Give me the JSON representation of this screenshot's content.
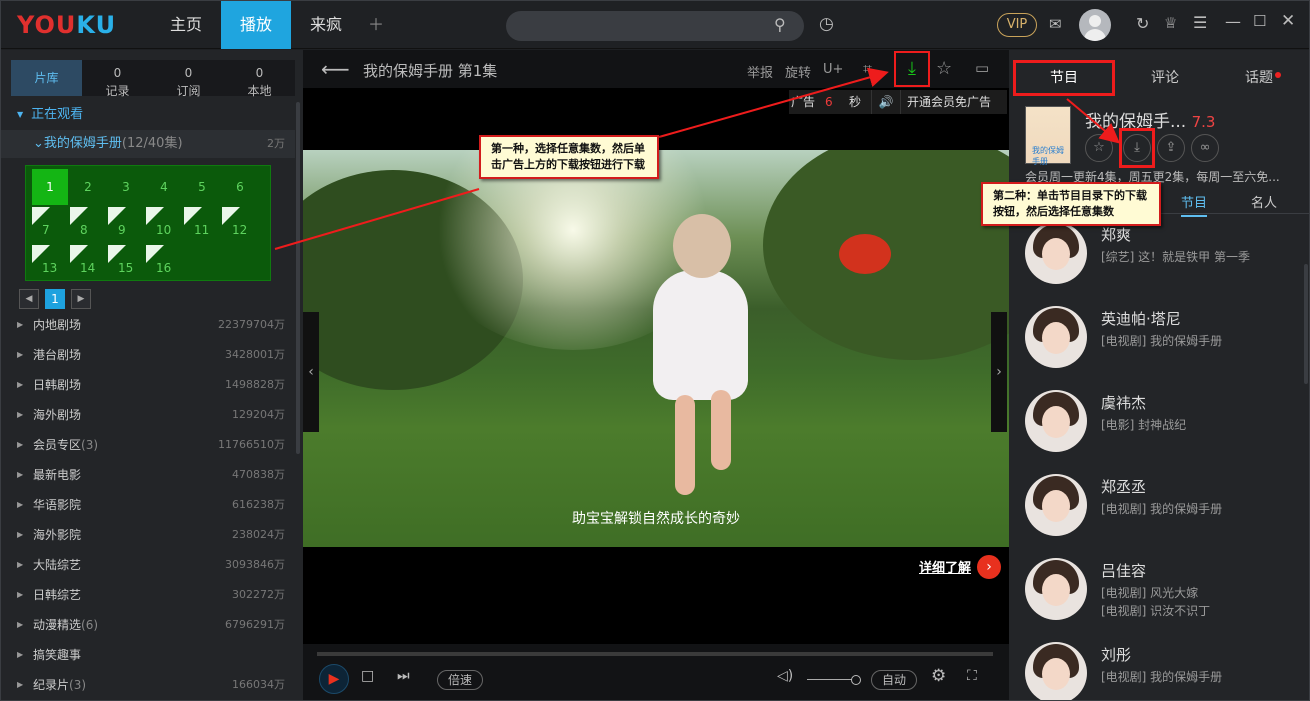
{
  "app": {
    "logo": "YOUKU",
    "nav": [
      "主页",
      "播放",
      "来疯"
    ],
    "nav_active_index": 1,
    "search_placeholder": "",
    "vip_label": "VIP"
  },
  "left_panel": {
    "tabs": [
      {
        "label": "片库",
        "count": ""
      },
      {
        "label": "记录",
        "count": "0"
      },
      {
        "label": "订阅",
        "count": "0"
      },
      {
        "label": "本地",
        "count": "0"
      }
    ],
    "watching_label": "正在观看",
    "current_show": {
      "name": "我的保姆手册",
      "count": "(12/40集)",
      "views": "2万"
    },
    "episodes": [
      "1",
      "2",
      "3",
      "4",
      "5",
      "6",
      "7",
      "8",
      "9",
      "10",
      "11",
      "12",
      "13",
      "14",
      "15",
      "16"
    ],
    "current_episode_index": 0,
    "flagged_from_index": 6,
    "page": "1",
    "categories": [
      {
        "name": "内地剧场",
        "count": "",
        "views": "22379704万"
      },
      {
        "name": "港台剧场",
        "count": "",
        "views": "3428001万"
      },
      {
        "name": "日韩剧场",
        "count": "",
        "views": "1498828万"
      },
      {
        "name": "海外剧场",
        "count": "",
        "views": "129204万"
      },
      {
        "name": "会员专区",
        "count": "(3)",
        "views": "11766510万"
      },
      {
        "name": "最新电影",
        "count": "",
        "views": "470838万"
      },
      {
        "name": "华语影院",
        "count": "",
        "views": "616238万"
      },
      {
        "name": "海外影院",
        "count": "",
        "views": "238024万"
      },
      {
        "name": "大陆综艺",
        "count": "",
        "views": "3093846万"
      },
      {
        "name": "日韩综艺",
        "count": "",
        "views": "302272万"
      },
      {
        "name": "动漫精选",
        "count": "(6)",
        "views": "6796291万"
      },
      {
        "name": "搞笑趣事",
        "count": "",
        "views": ""
      },
      {
        "name": "纪录片",
        "count": "(3)",
        "views": "166034万"
      }
    ]
  },
  "player": {
    "title": "我的保姆手册 第1集",
    "tools": [
      "举报",
      "旋转",
      "U+"
    ],
    "ad": {
      "label": "广告",
      "seconds": "6",
      "unit": "秒",
      "vip_skip": "开通会员免广告"
    },
    "subtitle": "助宝宝解锁自然成长的奇妙",
    "detail_link": "详细了解",
    "speed_label": "倍速",
    "quality_label": "自动"
  },
  "right_panel": {
    "tabs": [
      "节目",
      "评论",
      "话题"
    ],
    "show_title": "我的保姆手...",
    "score": "7.3",
    "poster_text": "我的保姆手册",
    "description": "会员周一更新4集，周五更2集，每周一至六免...",
    "subtabs": [
      "节目",
      "名人"
    ],
    "people": [
      {
        "name": "郑爽",
        "work": "[综艺] 这！就是铁甲 第一季",
        "work2": ""
      },
      {
        "name": "英迪帕·塔尼",
        "work": "[电视剧] 我的保姆手册",
        "work2": ""
      },
      {
        "name": "虞祎杰",
        "work": "[电影] 封神战纪",
        "work2": ""
      },
      {
        "name": "郑丞丞",
        "work": "[电视剧] 我的保姆手册",
        "work2": ""
      },
      {
        "name": "吕佳容",
        "work": "[电视剧] 风光大嫁",
        "work2": "[电视剧] 识汝不识丁"
      },
      {
        "name": "刘彤",
        "work": "[电视剧] 我的保姆手册",
        "work2": ""
      }
    ]
  },
  "annotations": {
    "note1": "第一种，选择任意集数，然后单击广告上方的下载按钮进行下载",
    "note2": "第二种：单击节目目录下的下载按钮，然后选择任意集数"
  },
  "colors": {
    "accent": "#1fa5df",
    "annotation_red": "#ee1c1c",
    "download_green": "#18c418",
    "score": "#ee4444"
  }
}
